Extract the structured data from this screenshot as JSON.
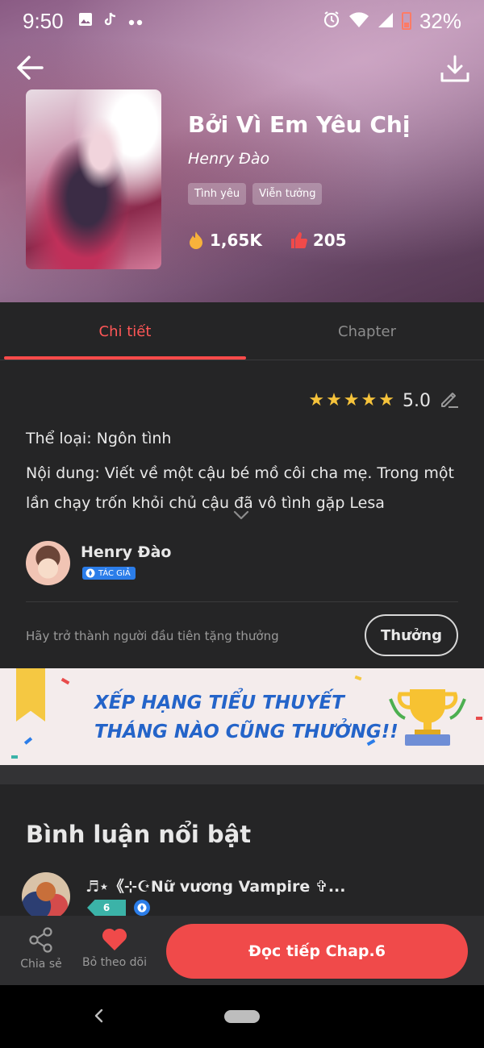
{
  "status_bar": {
    "time": "9:50",
    "battery_percent": "32%"
  },
  "book": {
    "title": "Bởi Vì Em Yêu Chị",
    "author": "Henry Đào",
    "tags": [
      "Tình yêu",
      "Viễn tưởng"
    ],
    "views": "1,65K",
    "likes": "205"
  },
  "tabs": [
    {
      "label": "Chi tiết",
      "active": true
    },
    {
      "label": "Chapter",
      "active": false
    }
  ],
  "details": {
    "rating": "5.0",
    "stars": 5,
    "genre_text": "Thể loại: Ngôn tình",
    "description": "Nội dung: Viết về một cậu bé mồ côi cha mẹ. Trong một lần chạy trốn khỏi chủ cậu đã vô tình gặp Lesa",
    "author_name": "Henry Đào",
    "author_badge": "TÁC GIẢ",
    "reward_prompt": "Hãy trở thành người đầu tiên tặng thưởng",
    "reward_button": "Thưởng"
  },
  "banner": {
    "line1": "XẾP HẠNG TIỂU THUYẾT",
    "line2": "THÁNG NÀO CŨNG THƯỞNG!!"
  },
  "comments": {
    "title": "Bình luận nổi bật",
    "first": {
      "name": "♬⋆《⊹☪Nữ vương Vampire ✞...",
      "level": "6"
    }
  },
  "bottom_bar": {
    "share_label": "Chia sẻ",
    "unfollow_label": "Bỏ theo dõi",
    "read_button": "Đọc tiếp Chap.6"
  },
  "colors": {
    "accent": "#f04a4a",
    "star": "#f6c33b",
    "panel": "#252526",
    "banner_text": "#2464c9"
  }
}
